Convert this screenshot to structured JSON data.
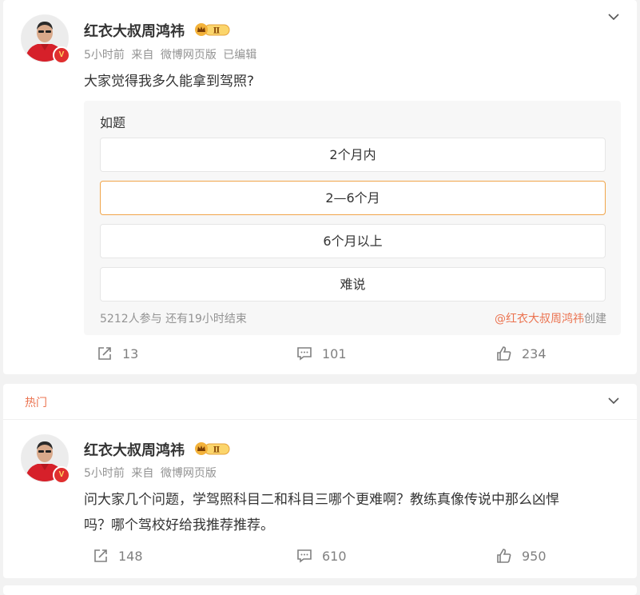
{
  "colors": {
    "accent": "#eb7350",
    "gold": "#f0a54a",
    "vip_red": "#e02f2f",
    "link": "#eb7350"
  },
  "icons": {
    "chevron": "chevron-down-icon",
    "repost": "repost-icon",
    "comment": "comment-icon",
    "like": "like-icon",
    "vip": "vip-crown-badge",
    "verified": "verified-v-badge"
  },
  "post1": {
    "username": "红衣大叔周鸿祎",
    "vip_level": "Ⅱ",
    "verified": "V",
    "time": "5小时前",
    "from_label": "来自",
    "source": "微博网页版",
    "edited": "已编辑",
    "text": "大家觉得我多久能拿到驾照?",
    "poll": {
      "title": "如题",
      "options": [
        "2个月内",
        "2—6个月",
        "6个月以上",
        "难说"
      ],
      "selected_index": 1,
      "participants": "5212人参与",
      "remaining": "还有19小时结束",
      "creator": "@红衣大叔周鸿祎",
      "created_label": "创建"
    },
    "reposts": "13",
    "comments": "101",
    "likes": "234"
  },
  "post2": {
    "section_label": "热门",
    "username": "红衣大叔周鸿祎",
    "vip_level": "Ⅱ",
    "verified": "V",
    "time": "5小时前",
    "from_label": "来自",
    "source": "微博网页版",
    "text_line1": "问大家几个问题，学驾照科目二和科目三哪个更难啊？教练真像传说中那么凶悍",
    "text_line2": "吗？哪个驾校好给我推荐推荐。",
    "reposts": "148",
    "comments": "610",
    "likes": "950"
  }
}
